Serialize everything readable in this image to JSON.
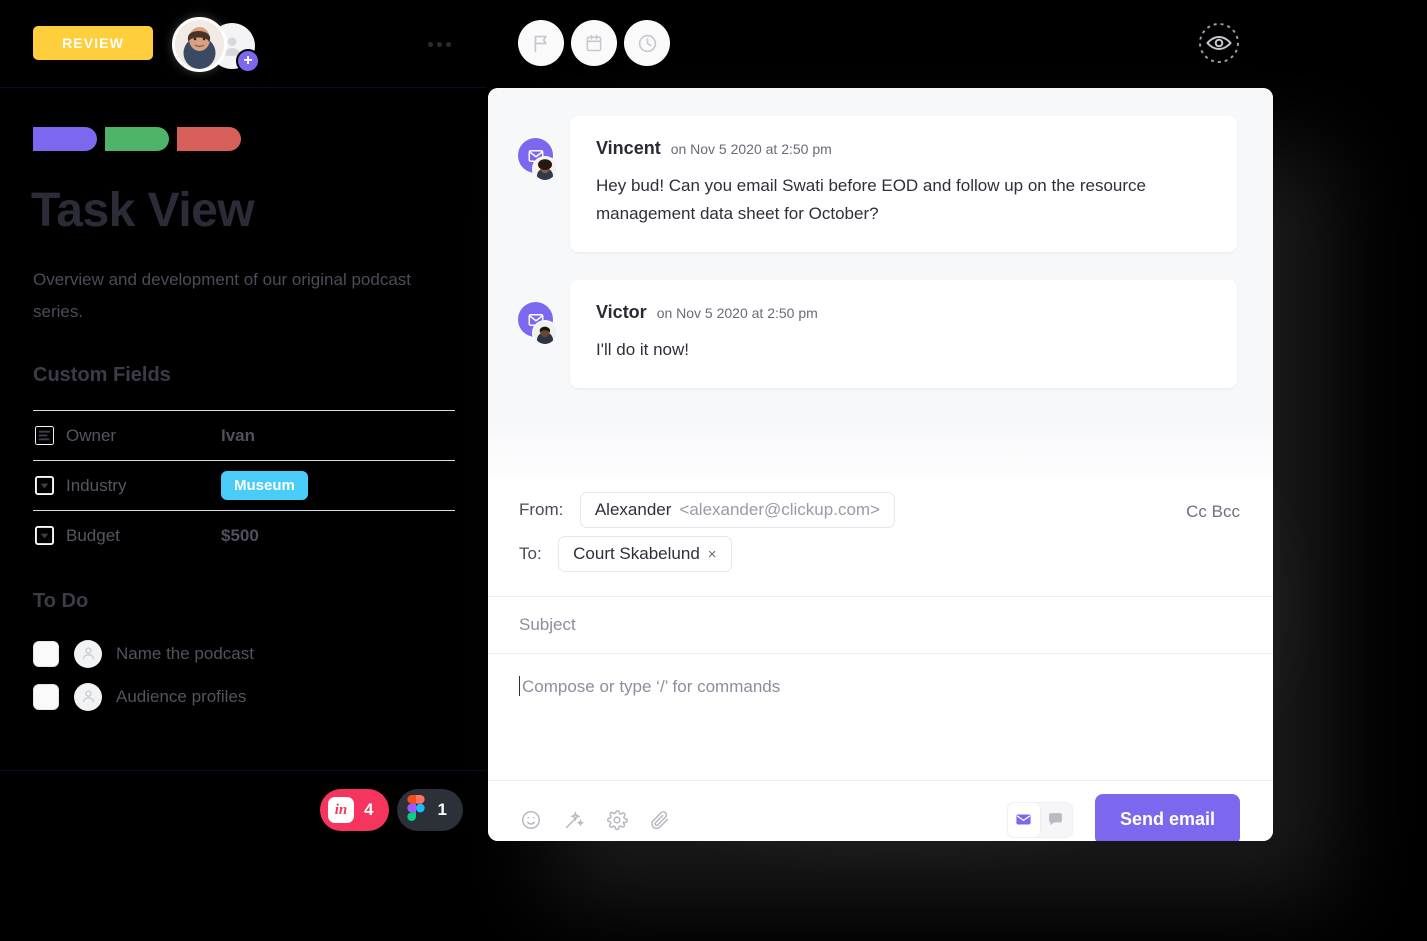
{
  "left_panel": {
    "status_badge": "REVIEW",
    "more_icon": "more-horizontal-icon",
    "tags": [
      {
        "name": "tag-purple",
        "color": "#7B68EE"
      },
      {
        "name": "tag-green",
        "color": "#4DB46A"
      },
      {
        "name": "tag-red",
        "color": "#D75F5A"
      }
    ],
    "title": "Task View",
    "description": "Overview and development of our original podcast series.",
    "custom_fields_heading": "Custom Fields",
    "custom_fields": [
      {
        "icon": "text-lines-icon",
        "name": "Owner",
        "value": "Ivan",
        "type": "text"
      },
      {
        "icon": "dropdown-icon",
        "name": "Industry",
        "value": "Museum",
        "type": "chip",
        "chip_color": "#49CCF9"
      },
      {
        "icon": "dropdown-icon",
        "name": "Budget",
        "value": "$500",
        "type": "text"
      }
    ],
    "todo_heading": "To Do",
    "todos": [
      {
        "label": "Name the podcast",
        "checked": false
      },
      {
        "label": "Audience profiles",
        "checked": false
      }
    ],
    "integrations": [
      {
        "app": "invision",
        "count": "4",
        "mark": "in",
        "color": "#F6355E"
      },
      {
        "app": "figma",
        "count": "1",
        "mark": "figma-logo",
        "color": "#2C3039"
      }
    ]
  },
  "toolbar": {
    "buttons": [
      {
        "name": "flag-icon",
        "label": "Flag"
      },
      {
        "name": "calendar-icon",
        "label": "Due date"
      },
      {
        "name": "clock-icon",
        "label": "Time tracking"
      }
    ],
    "watch": {
      "name": "eye-icon",
      "label": "Watch"
    }
  },
  "comments": [
    {
      "author": "Vincent",
      "time": "on Nov 5 2020 at 2:50 pm",
      "body": "Hey bud! Can you email Swati before EOD and follow up on the resource management data sheet for October?",
      "channel_icon": "envelope-icon"
    },
    {
      "author": "Victor",
      "time": "on Nov 5 2020 at 2:50 pm",
      "body": "I'll do it now!",
      "channel_icon": "envelope-icon"
    }
  ],
  "compose": {
    "from_label": "From:",
    "from_name": "Alexander",
    "from_email": "<alexander@clickup.com>",
    "to_label": "To:",
    "to_recipient": "Court Skabelund",
    "remove_recipient_glyph": "×",
    "cc_bcc": "Cc Bcc",
    "subject_placeholder": "Subject",
    "subject_value": "",
    "body_placeholder": "Compose or type ‘/’ for commands",
    "body_value": "",
    "tools": [
      {
        "name": "emoji-icon"
      },
      {
        "name": "magic-wand-icon"
      },
      {
        "name": "settings-gear-icon"
      },
      {
        "name": "paperclip-icon"
      }
    ],
    "mode_toggle": [
      {
        "name": "email-mode",
        "icon": "envelope-icon",
        "active": true
      },
      {
        "name": "comment-mode",
        "icon": "comment-bubble-icon",
        "active": false
      }
    ],
    "send_label": "Send email",
    "send_color": "#7B68EE"
  }
}
